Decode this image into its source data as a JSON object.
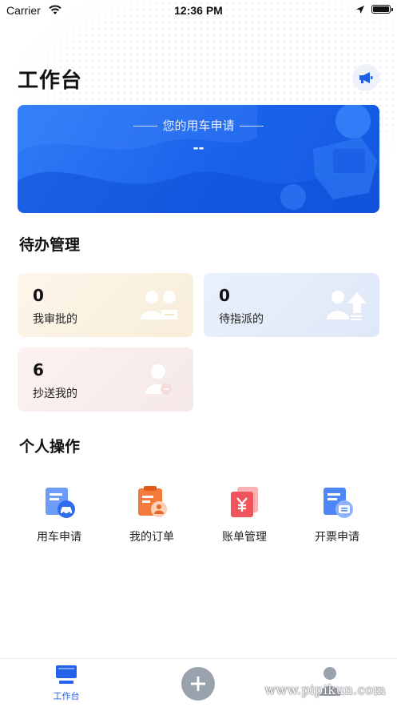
{
  "status_bar": {
    "carrier": "Carrier",
    "time": "12:36 PM"
  },
  "header": {
    "title": "工作台",
    "notice_icon": "megaphone-icon"
  },
  "banner": {
    "title": "您的用车申请",
    "value": "--",
    "colors": {
      "start": "#2f7cf6",
      "end": "#1558e0"
    }
  },
  "todo": {
    "section_title": "待办管理",
    "cards": [
      {
        "count": "0",
        "label": "我审批的",
        "icon": "approval-users-icon",
        "bg": "#fbf3e6"
      },
      {
        "count": "0",
        "label": "待指派的",
        "icon": "assign-user-icon",
        "bg": "#e8eefa"
      },
      {
        "count": "6",
        "label": "抄送我的",
        "icon": "cc-user-icon",
        "bg": "#faf0ef"
      }
    ]
  },
  "personal": {
    "section_title": "个人操作",
    "actions": [
      {
        "label": "用车申请",
        "icon": "car-request-icon"
      },
      {
        "label": "我的订单",
        "icon": "my-orders-icon"
      },
      {
        "label": "账单管理",
        "icon": "bill-yuan-icon"
      },
      {
        "label": "开票申请",
        "icon": "invoice-icon"
      }
    ]
  },
  "tabbar": {
    "home_label": "工作台",
    "add_icon": "plus-icon",
    "mine_icon": "user-icon",
    "watermark": "www.pipikun.com",
    "active_color": "#2462e8"
  }
}
